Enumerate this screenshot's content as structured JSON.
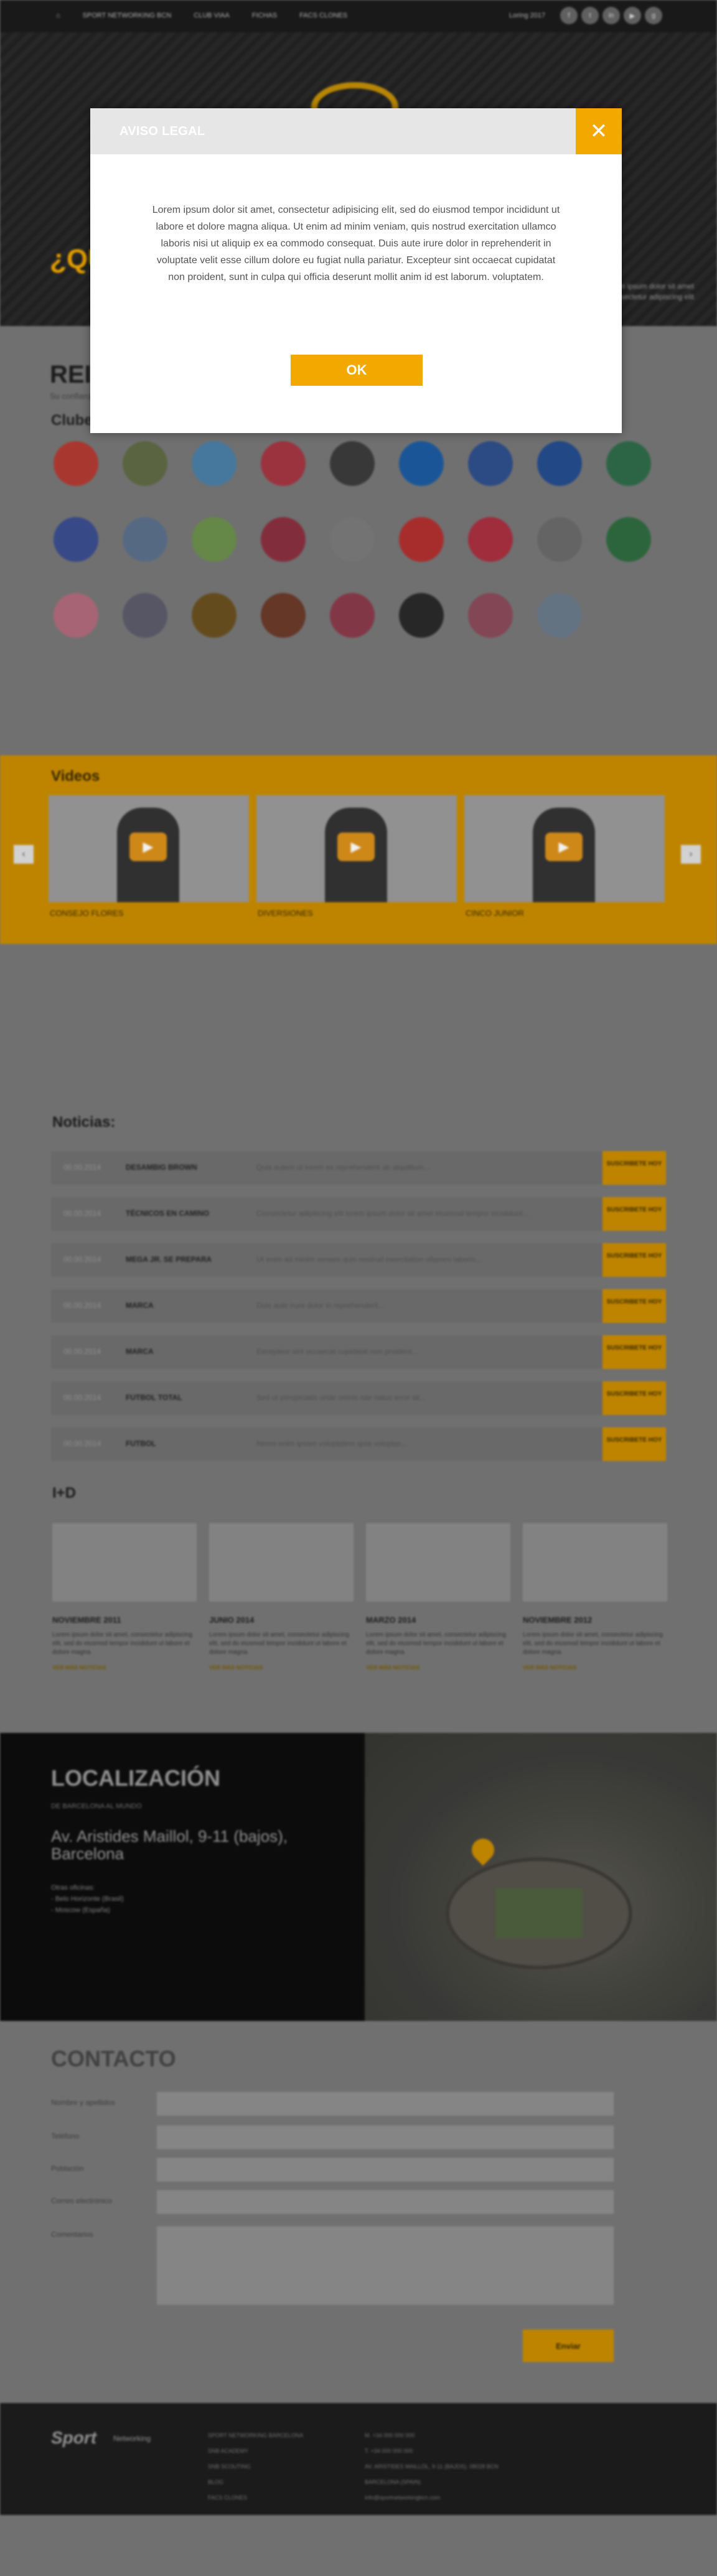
{
  "topbar": {
    "nav": [
      "SPORT NETWORKING BCN",
      "CLUB VIAA",
      "FICHAS",
      "FACS CLONES"
    ],
    "login": "Loring 2017",
    "social_icons": [
      "facebook-icon",
      "twitter-icon",
      "linkedin-icon",
      "youtube-icon",
      "google-icon"
    ]
  },
  "hero": {
    "question": "¿QU",
    "side_text": "Lorem ipsum dolor sit amet consectetur adipiscing elit"
  },
  "representacion": {
    "title": "REI",
    "subtitle": "Su confianza"
  },
  "clubes": {
    "title": "Clubes:",
    "logo_colors": [
      "#b23b32",
      "#5f6a44",
      "#4a7fa6",
      "#a43642",
      "#3c3c3c",
      "#1c5ba0",
      "#2f4f8c",
      "#244c8e",
      "#2f6b4a",
      "#3a4d8f",
      "#5b6f8a",
      "#6b8f4c",
      "#8a3040",
      "#7a7a7a",
      "#b03030",
      "#a83040",
      "#6a6a6a",
      "#2f6b3f",
      "#b06a7c",
      "#5b5b6b",
      "#6a5020",
      "#6a3a2a",
      "#8a3a4a",
      "#2a2a2a",
      "#8a4a5a",
      "#6a7a8a"
    ]
  },
  "videos": {
    "title": "Videos",
    "captions": [
      "CONSEJO FLORES",
      "DIVERSIONES",
      "CINCO JUNIOR"
    ]
  },
  "noticias": {
    "title": "Noticias:",
    "button_label": "SUSCRIBETE HOY",
    "items": [
      {
        "date": "00.00.2014",
        "title": "DESAMBIG BROWN",
        "text": "Quis autem ut lorem ex reprehenderit ab alquillium..."
      },
      {
        "date": "00.00.2014",
        "title": "TÉCNICOS EN CAMINO",
        "text": "Consectetur adipiscing elit lorem ipsum dolor sit amet eiusmod tempor incididunt..."
      },
      {
        "date": "00.00.2014",
        "title": "MEGA JR. SE PREPARA",
        "text": "Ut enim ad minim veniam quis nostrud exercitation ullamco laboris..."
      },
      {
        "date": "00.00.2014",
        "title": "MARCA",
        "text": "Duis aute irure dolor in reprehenderit..."
      },
      {
        "date": "00.00.2014",
        "title": "MARCA",
        "text": "Excepteur sint occaecat cupidatat non proident..."
      },
      {
        "date": "00.00.2014",
        "title": "FUTBOL TOTAL",
        "text": "Sed ut perspiciatis unde omnis iste natus error sit..."
      },
      {
        "date": "00.00.2014",
        "title": "FUTBOL",
        "text": "Nemo enim ipsam voluptatem quia voluptas..."
      }
    ]
  },
  "id": {
    "title": "I+D",
    "read_more": "VER MÁS NOTICIAS",
    "items": [
      {
        "month": "NOVIEMBRE 2011",
        "text": "Lorem ipsum dolor sit amet, consectetur adipiscing elit, sed do eiusmod tempor incididunt ut labore et dolore magna."
      },
      {
        "month": "JUNIO 2014",
        "text": "Lorem ipsum dolor sit amet, consectetur adipiscing elit, sed do eiusmod tempor incididunt ut labore et dolore magna."
      },
      {
        "month": "MARZO 2014",
        "text": "Lorem ipsum dolor sit amet, consectetur adipiscing elit, sed do eiusmod tempor incididunt ut labore et dolore magna."
      },
      {
        "month": "NOVIEMBRE 2012",
        "text": "Lorem ipsum dolor sit amet, consectetur adipiscing elit, sed do eiusmod tempor incididunt ut labore et dolore magna."
      }
    ]
  },
  "localizacion": {
    "title": "LOCALIZACIÓN",
    "subtitle": "DE BARCELONA AL MUNDO",
    "address": "Av. Aristides Maillol, 9-11 (bajos), Barcelona",
    "offices_title": "Otras oficinas:",
    "offices": [
      "- Belo Horizonte (Brasil)",
      "- Moscow (España)"
    ]
  },
  "contacto": {
    "title": "CONTACTO",
    "fields": [
      "Nombre y apellidos",
      "Teléfono",
      "Población",
      "Correo electrónico",
      "Comentarios"
    ],
    "submit": "Enviar"
  },
  "footer": {
    "logo_word": "Sport",
    "logo_sub": "Networking",
    "col1": [
      "SPORT NETWORKING BARCELONA",
      "SNB ACADEMY",
      "SNB SCOUTING",
      "BLOG",
      "FACS CLONES"
    ],
    "col2": [
      "M. +34 000 000 000",
      "T. +34 000 000 000",
      "AV. ARISTIDES MAILLOL, 9-11 (BAJOS). 08028 BCN",
      "BARCELONA (SPAIN)",
      "info@sportnetworkingbcn.com"
    ]
  },
  "modal": {
    "title": "AVISO LEGAL",
    "close": "✕",
    "body": "Lorem ipsum dolor sit amet, consectetur adipisicing elit, sed do eiusmod tempor incididunt ut labore et dolore magna aliqua. Ut enim ad minim veniam, quis nostrud exercitation ullamco laboris nisi ut aliquip ex ea commodo consequat. Duis aute irure dolor in reprehenderit in voluptate velit esse cillum dolore eu fugiat nulla pariatur. Excepteur sint occaecat cupidatat non proident, sunt in culpa qui officia deserunt mollit anim id est laborum. voluptatem.",
    "ok": "OK"
  },
  "colors": {
    "accent": "#f3a800",
    "overlay": "#777777"
  }
}
